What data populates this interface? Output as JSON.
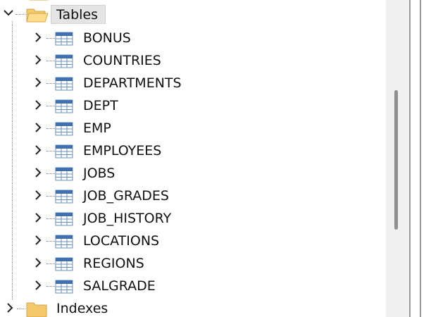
{
  "tree": {
    "tables_node": {
      "label": "Tables",
      "expanded": true,
      "selected": true,
      "icon": "folder-open-icon"
    },
    "tables": [
      {
        "label": "BONUS",
        "icon": "table-icon"
      },
      {
        "label": "COUNTRIES",
        "icon": "table-icon"
      },
      {
        "label": "DEPARTMENTS",
        "icon": "table-icon"
      },
      {
        "label": "DEPT",
        "icon": "table-icon"
      },
      {
        "label": "EMP",
        "icon": "table-icon"
      },
      {
        "label": "EMPLOYEES",
        "icon": "table-icon"
      },
      {
        "label": "JOBS",
        "icon": "table-icon"
      },
      {
        "label": "JOB_GRADES",
        "icon": "table-icon"
      },
      {
        "label": "JOB_HISTORY",
        "icon": "table-icon"
      },
      {
        "label": "LOCATIONS",
        "icon": "table-icon"
      },
      {
        "label": "REGIONS",
        "icon": "table-icon"
      },
      {
        "label": "SALGRADE",
        "icon": "table-icon"
      }
    ],
    "indexes_node": {
      "label": "Indexes",
      "expanded": false,
      "icon": "folder-icon"
    }
  },
  "colors": {
    "selection": "#e4e4e4",
    "folder": "#f5c86a",
    "table_header": "#3f6fb0",
    "connector": "#8a8a8a",
    "scrollbar_thumb": "#8f8f8f"
  }
}
